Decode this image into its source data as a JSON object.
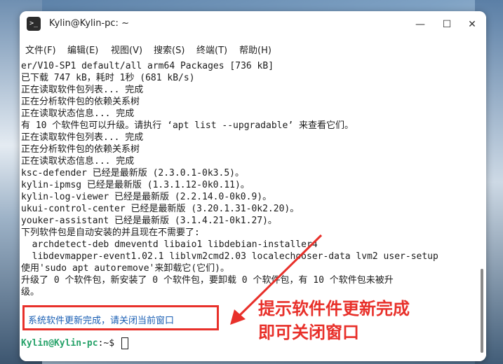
{
  "window": {
    "title": "Kylin@Kylin-pc: ~",
    "icon_label": ">_",
    "controls": {
      "minimize": "—",
      "maximize": "☐",
      "close": "✕"
    }
  },
  "menu": [
    {
      "label": "文件(F)"
    },
    {
      "label": "编辑(E)"
    },
    {
      "label": "视图(V)"
    },
    {
      "label": "搜索(S)"
    },
    {
      "label": "终端(T)"
    },
    {
      "label": "帮助(H)"
    }
  ],
  "terminal": {
    "lines": [
      "er/V10-SP1 default/all arm64 Packages [736 kB]",
      "已下载 747 kB，耗时 1秒 (681 kB/s)",
      "正在读取软件包列表... 完成",
      "正在分析软件包的依赖关系树",
      "正在读取状态信息... 完成",
      "有 10 个软件包可以升级。请执行 ‘apt list --upgradable’ 来查看它们。",
      "正在读取软件包列表... 完成",
      "正在分析软件包的依赖关系树",
      "正在读取状态信息... 完成",
      "ksc-defender 已经是最新版 (2.3.0.1-0k3.5)。",
      "kylin-ipmsg 已经是最新版 (1.3.1.12-0k0.11)。",
      "kylin-log-viewer 已经是最新版 (2.2.14.0-0k0.9)。",
      "ukui-control-center 已经是最新版 (3.20.1.31-0k2.20)。",
      "youker-assistant 已经是最新版 (3.1.4.21-0k1.27)。",
      "下列软件包是自动安装的并且现在不需要了:",
      "  archdetect-deb dmeventd libaio1 libdebian-installer4",
      "  libdevmapper-event1.02.1 liblvm2cmd2.03 localechooser-data lvm2 user-setup",
      "使用'sudo apt autoremove'来卸载它(它们)。",
      "升级了 0 个软件包，新安装了 0 个软件包，要卸载 0 个软件包，有 10 个软件包未被升",
      "级。"
    ],
    "completion_message": "系统软件更新完成，请关闭当前窗口",
    "prompt_user": "Kylin@Kylin-pc",
    "prompt_rest": ":~$ "
  },
  "annotation": {
    "line1": "提示软件件更新完成",
    "line2": "即可关闭窗口"
  },
  "colors": {
    "prompt": "#26a269",
    "message": "#1a5fb4",
    "annotation": "#e8302a"
  }
}
